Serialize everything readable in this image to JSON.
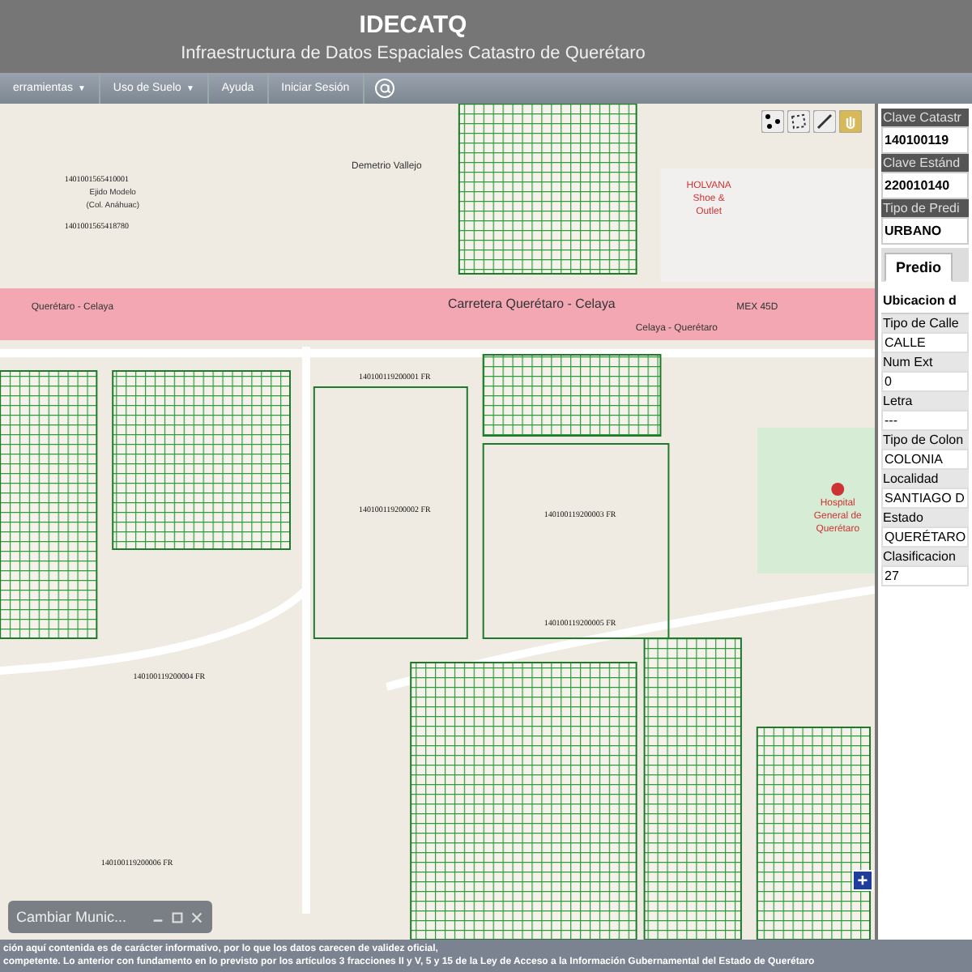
{
  "header": {
    "title": "IDECATQ",
    "subtitle": "Infraestructura de Datos Espaciales Catastro de Querétaro"
  },
  "menu": [
    {
      "label": "erramientas",
      "caret": "▼"
    },
    {
      "label": "Uso de Suelo",
      "caret": "▼"
    },
    {
      "label": "Ayuda"
    },
    {
      "label": "Iniciar Sesión"
    }
  ],
  "map": {
    "labels": [
      "Querétaro - Celaya",
      "Carretera Querétaro - Celaya",
      "Celaya - Querétaro",
      "MEX 45D",
      "Demetrio Vallejo",
      "Ejido Modelo",
      "(Col. Anáhuac)",
      "Hospital",
      "General de",
      "Querétaro",
      "HOLVANA",
      "Shoe &",
      "Outlet"
    ],
    "parcel_ids": [
      "1401001565410001",
      "1401001565418780",
      "140100119200001 FR",
      "140100119200002 FR",
      "140100119200003 FR",
      "140100119200004 FR",
      "140100119200005 FR",
      "140100119200006 FR"
    ],
    "zoom_in": "+"
  },
  "floating_window": {
    "title": "Cambiar Munic..."
  },
  "panel": {
    "fields": [
      {
        "label": "Clave Catastr",
        "value": "140100119"
      },
      {
        "label": "Clave Estánd",
        "value": "220010140"
      },
      {
        "label": "Tipo de Predi",
        "value": "URBANO"
      }
    ],
    "tabs": [
      {
        "label": "Predio",
        "selected": true
      }
    ],
    "section": "Ubicacion d",
    "rows": [
      {
        "label": "Tipo de Calle",
        "value": "CALLE"
      },
      {
        "label": "Num Ext",
        "value": "0"
      },
      {
        "label": "Letra",
        "value": "---"
      },
      {
        "label": "Tipo de Colon",
        "value": "COLONIA"
      },
      {
        "label": "Localidad",
        "value": "SANTIAGO D"
      },
      {
        "label": "Estado",
        "value": "QUERÉTARO"
      },
      {
        "label": "Clasificacion",
        "value": "27"
      }
    ]
  },
  "footer": [
    "ción aquí contenida es de carácter informativo, por lo que los datos carecen de validez oficial,",
    "competente. Lo anterior con fundamento en lo previsto por los artículos 3 fracciones II y V, 5 y 15 de la Ley de Acceso a la Información Gubernamental del Estado de Querétaro"
  ]
}
